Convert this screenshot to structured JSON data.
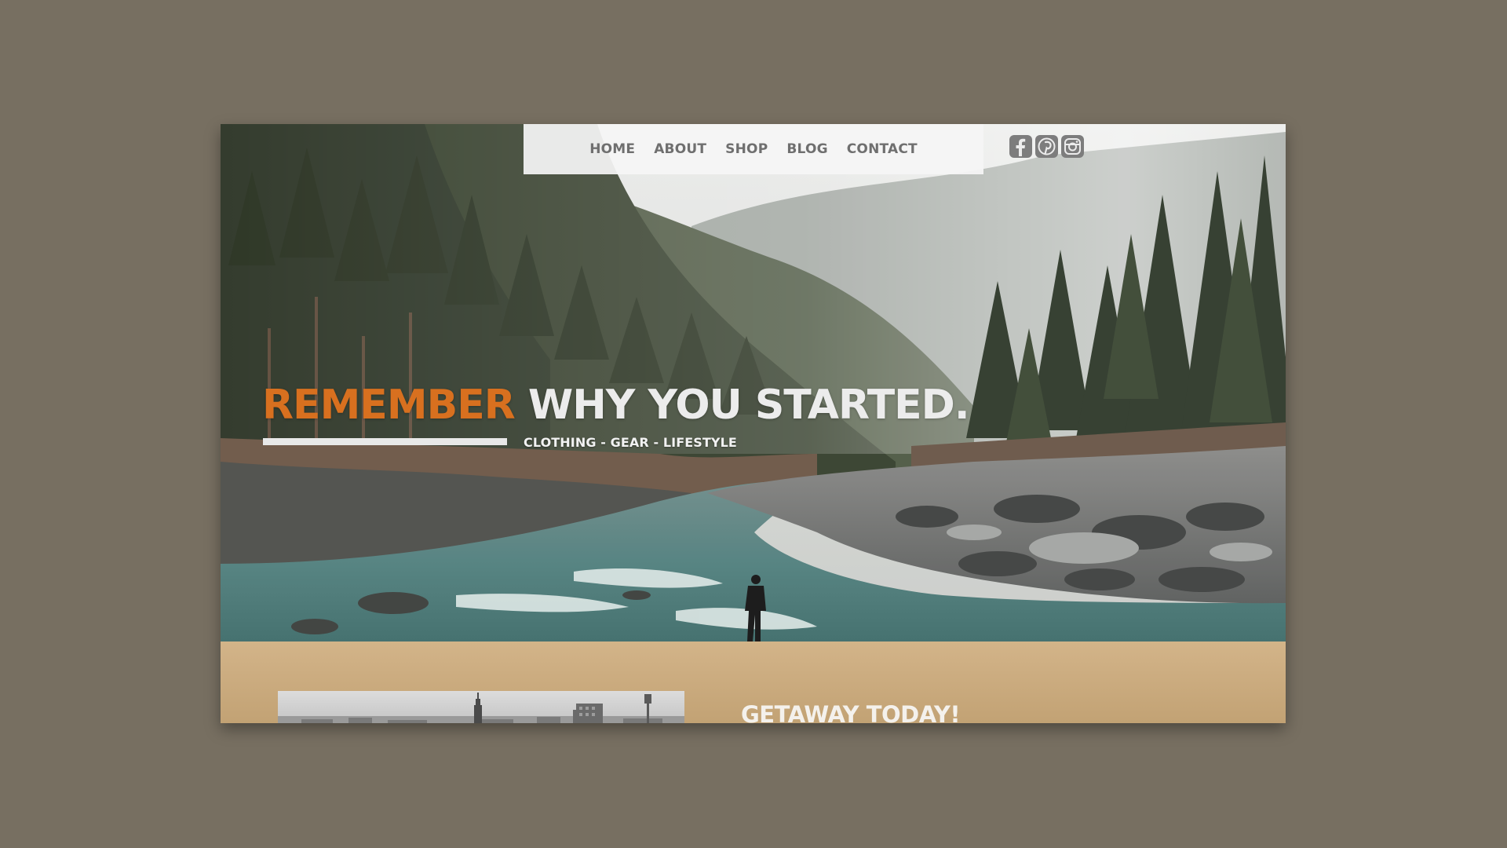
{
  "nav": {
    "items": [
      {
        "label": "HOME"
      },
      {
        "label": "ABOUT"
      },
      {
        "label": "SHOP"
      },
      {
        "label": "BLOG"
      },
      {
        "label": "CONTACT"
      }
    ]
  },
  "social": {
    "icons": [
      "facebook-icon",
      "pinterest-icon",
      "instagram-icon"
    ]
  },
  "hero": {
    "headline_accent": "REMEMBER",
    "headline_rest": "WHY YOU STARTED.",
    "tagline": "CLOTHING - GEAR - LIFESTYLE"
  },
  "section": {
    "heading": "GETAWAY TODAY!"
  },
  "colors": {
    "backdrop": "#776f61",
    "accent": "#d8701f",
    "lower_band": "#cdb083",
    "nav_text": "#6f6f6f"
  }
}
